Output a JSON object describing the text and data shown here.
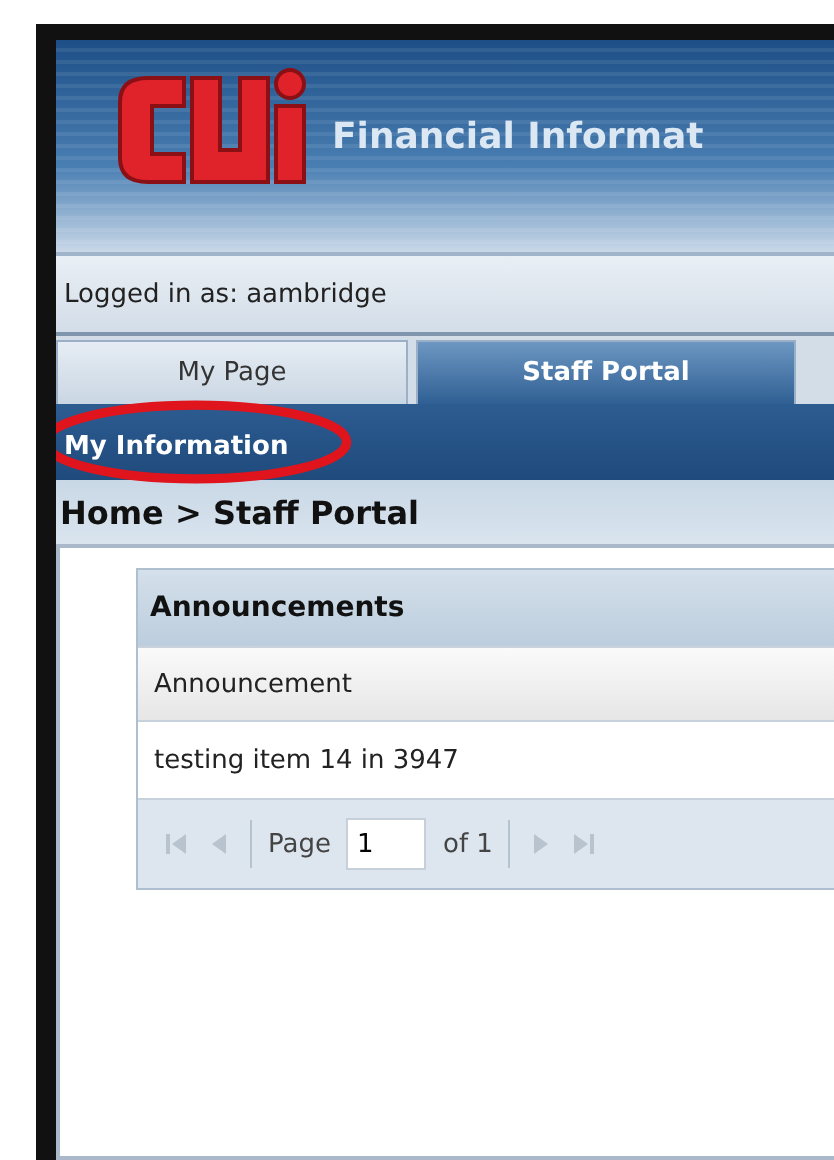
{
  "header": {
    "title": "Financial Informat"
  },
  "user_bar": {
    "text": "Logged in as: aambridge"
  },
  "tabs": [
    {
      "label": "My Page",
      "selected": false
    },
    {
      "label": "Staff Portal",
      "selected": true
    }
  ],
  "menu": {
    "items": [
      {
        "label": "My Information",
        "highlighted": true
      }
    ]
  },
  "breadcrumb": "Home > Staff Portal",
  "announcements": {
    "title": "Announcements",
    "columns": [
      "Announcement"
    ],
    "rows": [
      [
        "testing item 14 in 3947"
      ]
    ],
    "pager": {
      "label": "Page",
      "value": "1",
      "of": "of 1",
      "first_disabled": true,
      "prev_disabled": true,
      "next_disabled": true,
      "last_disabled": true
    }
  }
}
